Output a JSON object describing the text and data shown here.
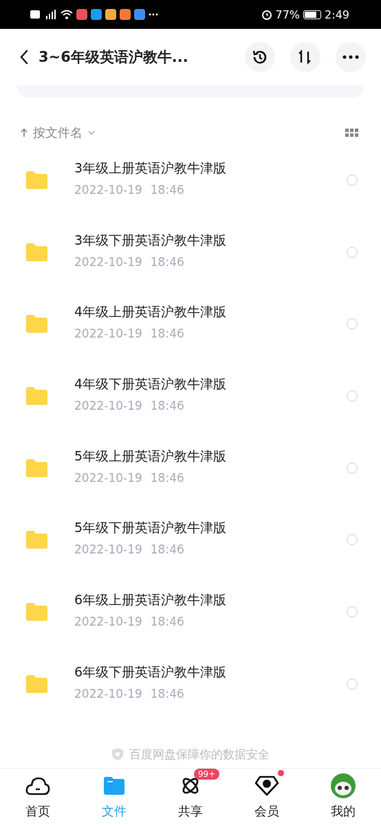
{
  "status_bar": {
    "battery_text": "77%",
    "time": "2:49"
  },
  "header": {
    "title": "3~6年级英语沪教牛..."
  },
  "sort_bar": {
    "label": "按文件名"
  },
  "files": [
    {
      "name": "3年级上册英语沪教牛津版",
      "date": "2022-10-19",
      "time": "18:46",
      "selected": false
    },
    {
      "name": "3年级下册英语沪教牛津版",
      "date": "2022-10-19",
      "time": "18:46",
      "selected": false
    },
    {
      "name": "4年级上册英语沪教牛津版",
      "date": "2022-10-19",
      "time": "18:46",
      "selected": false
    },
    {
      "name": "4年级下册英语沪教牛津版",
      "date": "2022-10-19",
      "time": "18:46",
      "selected": false
    },
    {
      "name": "5年级上册英语沪教牛津版",
      "date": "2022-10-19",
      "time": "18:46",
      "selected": false
    },
    {
      "name": "5年级下册英语沪教牛津版",
      "date": "2022-10-19",
      "time": "18:46",
      "selected": false
    },
    {
      "name": "6年级上册英语沪教牛津版",
      "date": "2022-10-19",
      "time": "18:46",
      "selected": false
    },
    {
      "name": "6年级下册英语沪教牛津版",
      "date": "2022-10-19",
      "time": "18:46",
      "selected": false
    }
  ],
  "footer_note": "百度网盘保障你的数据安全",
  "nav": [
    {
      "kind": "home",
      "label": "首页",
      "selected": false
    },
    {
      "kind": "files",
      "label": "文件",
      "selected": true
    },
    {
      "kind": "share",
      "label": "共享",
      "selected": false,
      "badge": "99+"
    },
    {
      "kind": "vip",
      "label": "会员",
      "selected": false,
      "dot": true
    },
    {
      "kind": "me",
      "label": "我的",
      "selected": false
    }
  ]
}
